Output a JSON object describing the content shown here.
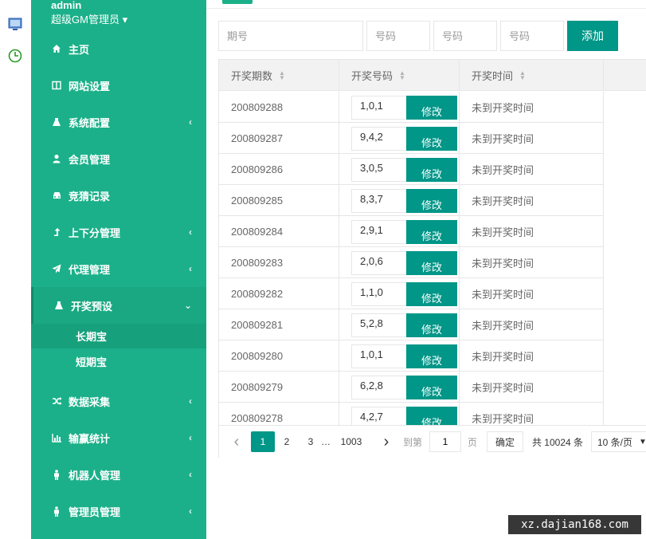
{
  "user": {
    "name": "admin",
    "role": "超级GM管理员"
  },
  "sidebar": {
    "items": [
      {
        "label": "主页",
        "icon": "home-icon",
        "arrow": false
      },
      {
        "label": "网站设置",
        "icon": "columns-icon",
        "arrow": false
      },
      {
        "label": "系统配置",
        "icon": "flask-icon",
        "arrow": true
      },
      {
        "label": "会员管理",
        "icon": "user-icon",
        "arrow": false
      },
      {
        "label": "竞猜记录",
        "icon": "car-icon",
        "arrow": false
      },
      {
        "label": "上下分管理",
        "icon": "level-up-icon",
        "arrow": true
      },
      {
        "label": "代理管理",
        "icon": "paper-plane-icon",
        "arrow": true
      },
      {
        "label": "开奖预设",
        "icon": "flask-icon",
        "arrow": true,
        "expanded": true
      },
      {
        "label": "数据采集",
        "icon": "random-icon",
        "arrow": true
      },
      {
        "label": "输赢统计",
        "icon": "bar-chart-icon",
        "arrow": true
      },
      {
        "label": "机器人管理",
        "icon": "male-icon",
        "arrow": true
      },
      {
        "label": "管理员管理",
        "icon": "male-icon",
        "arrow": true
      }
    ],
    "subitems": [
      {
        "label": "长期宝"
      },
      {
        "label": "短期宝"
      }
    ]
  },
  "form": {
    "issue_placeholder": "期号",
    "code_placeholder_1": "号码",
    "code_placeholder_2": "号码",
    "code_placeholder_3": "号码",
    "add_label": "添加"
  },
  "table": {
    "headers": [
      "开奖期数",
      "开奖号码",
      "开奖时间"
    ],
    "edit_label": "修改",
    "rows": [
      {
        "issue": "200809288",
        "code": "1,0,1",
        "time": "未到开奖时间"
      },
      {
        "issue": "200809287",
        "code": "9,4,2",
        "time": "未到开奖时间"
      },
      {
        "issue": "200809286",
        "code": "3,0,5",
        "time": "未到开奖时间"
      },
      {
        "issue": "200809285",
        "code": "8,3,7",
        "time": "未到开奖时间"
      },
      {
        "issue": "200809284",
        "code": "2,9,1",
        "time": "未到开奖时间"
      },
      {
        "issue": "200809283",
        "code": "2,0,6",
        "time": "未到开奖时间"
      },
      {
        "issue": "200809282",
        "code": "1,1,0",
        "time": "未到开奖时间"
      },
      {
        "issue": "200809281",
        "code": "5,2,8",
        "time": "未到开奖时间"
      },
      {
        "issue": "200809280",
        "code": "1,0,1",
        "time": "未到开奖时间"
      },
      {
        "issue": "200809279",
        "code": "6,2,8",
        "time": "未到开奖时间"
      },
      {
        "issue": "200809278",
        "code": "4,2,7",
        "time": "未到开奖时间"
      }
    ]
  },
  "pager": {
    "prev": "‹",
    "pages": [
      "1",
      "2",
      "3"
    ],
    "ellipsis": "…",
    "last": "1003",
    "next": "›",
    "goto_label": "到第",
    "goto_value": "1",
    "page_unit": "页",
    "confirm": "确定",
    "total": "共 10024 条",
    "per_page": "10 条/页"
  },
  "watermark": "xz.dajian168.com",
  "colors": {
    "sidebar": "#1bb089",
    "primary": "#009688"
  }
}
